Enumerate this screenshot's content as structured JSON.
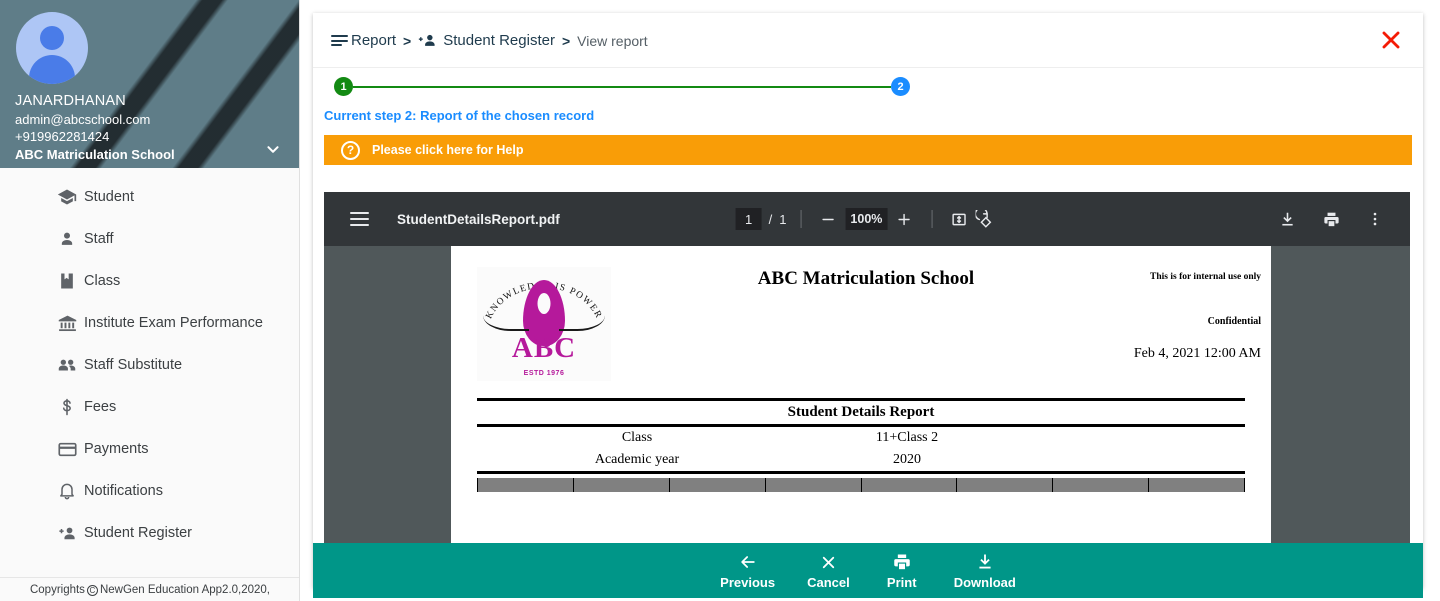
{
  "sidebar": {
    "user": {
      "name": "JANARDHANAN",
      "email": "admin@abcschool.com",
      "phone": "+919962281424",
      "school": "ABC Matriculation School"
    },
    "items": [
      {
        "label": "Student",
        "icon": "graduation-cap-icon"
      },
      {
        "label": "Staff",
        "icon": "person-icon"
      },
      {
        "label": "Class",
        "icon": "bookmark-icon"
      },
      {
        "label": "Institute Exam Performance",
        "icon": "institute-icon"
      },
      {
        "label": "Staff Substitute",
        "icon": "people-icon"
      },
      {
        "label": "Fees",
        "icon": "dollar-icon"
      },
      {
        "label": "Payments",
        "icon": "credit-card-icon"
      },
      {
        "label": "Notifications",
        "icon": "bell-icon"
      },
      {
        "label": "Student Register",
        "icon": "person-add-icon"
      }
    ],
    "copyright_prefix": "Copyrights",
    "copyright_suffix": "NewGen Education App2.0,2020,"
  },
  "header": {
    "breadcrumb": [
      {
        "label": "Report"
      },
      {
        "label": "Student Register"
      },
      {
        "label": "View report"
      }
    ],
    "separator": ">"
  },
  "stepper": {
    "step1": "1",
    "step2": "2",
    "current_step_text": "Current step 2: Report of the chosen record",
    "colors": {
      "completed": "#138a13",
      "current": "#1a8cff"
    }
  },
  "help": {
    "icon": "?",
    "text": "Please click here for Help",
    "color": "#f99d07"
  },
  "pdf_toolbar": {
    "filename": "StudentDetailsReport.pdf",
    "page_current": "1",
    "page_separator": "/",
    "page_total": "1",
    "zoom_level": "100%",
    "minus_label": "−",
    "plus_label": "+"
  },
  "document": {
    "school_name": "ABC Matriculation School",
    "internal_use": "This is for internal use only",
    "confidential": "Confidential",
    "date": "Feb 4, 2021 12:00 AM",
    "logo": {
      "motto": "KNOWLEDGE IS POWER",
      "acronym": "ABC",
      "established": "ESTD 1976"
    },
    "report_title": "Student Details Report",
    "meta_rows": [
      {
        "label": "Class",
        "value": "11+Class 2"
      },
      {
        "label": "Academic year",
        "value": "2020"
      }
    ]
  },
  "action_bar": {
    "color": "#009688",
    "buttons": [
      {
        "label": "Previous",
        "icon": "arrow-back-icon"
      },
      {
        "label": "Cancel",
        "icon": "close-icon"
      },
      {
        "label": "Print",
        "icon": "printer-icon"
      },
      {
        "label": "Download",
        "icon": "download-icon"
      }
    ]
  }
}
